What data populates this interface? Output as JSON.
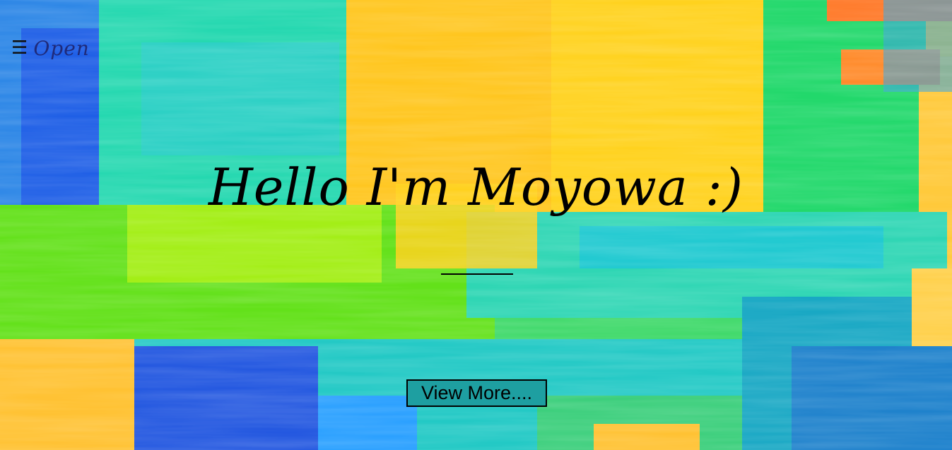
{
  "nav": {
    "menu_icon": "☰",
    "open_label": "Open"
  },
  "hero": {
    "headline": "Hello I'm Moyowa :)",
    "cta_label": "View More....",
    "background": "abstract-paint-strokes",
    "colors": {
      "yellow": "#ffc21a",
      "green": "#5be01c",
      "teal": "#1fd0c0",
      "blue": "#2264e0",
      "button_bg": "#1e9fa1",
      "text": "#000000"
    }
  }
}
